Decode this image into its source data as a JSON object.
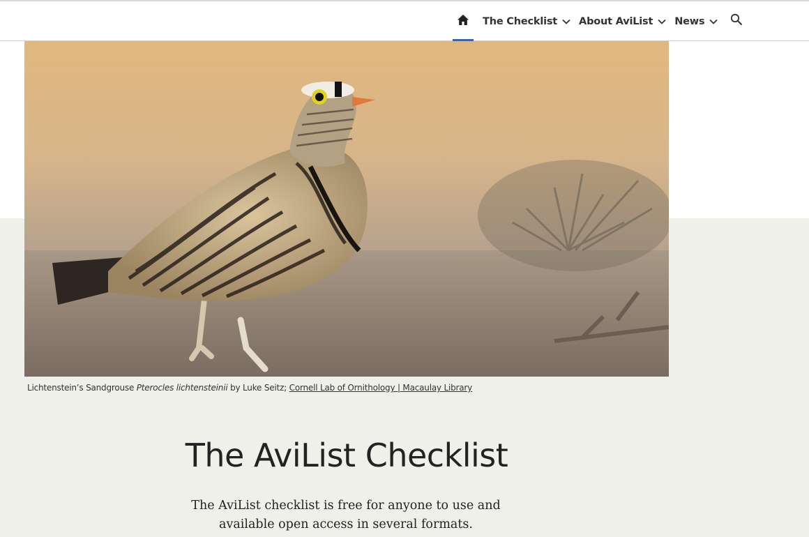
{
  "nav": {
    "home_icon": "home-icon",
    "items": [
      {
        "label": "The Checklist",
        "icon": "chevron-down-icon"
      },
      {
        "label": "About AviList",
        "icon": "chevron-down-icon"
      },
      {
        "label": "News",
        "icon": "chevron-down-icon"
      }
    ],
    "search_icon": "search-icon",
    "active_color": "#3a66a8"
  },
  "hero": {
    "caption": {
      "common_name": "Lichtenstein’s Sandgrouse",
      "scientific_name": "Pterocles lichtensteinii",
      "credit": "by Luke Seitz;",
      "link_text": "Cornell Lab of Ornithology | Macaulay Library"
    }
  },
  "main": {
    "title": "The AviList Checklist",
    "lede": "The AviList checklist is free for anyone to use and available open access in several formats."
  },
  "colors": {
    "band": "#eff0ea",
    "text": "#222222"
  }
}
